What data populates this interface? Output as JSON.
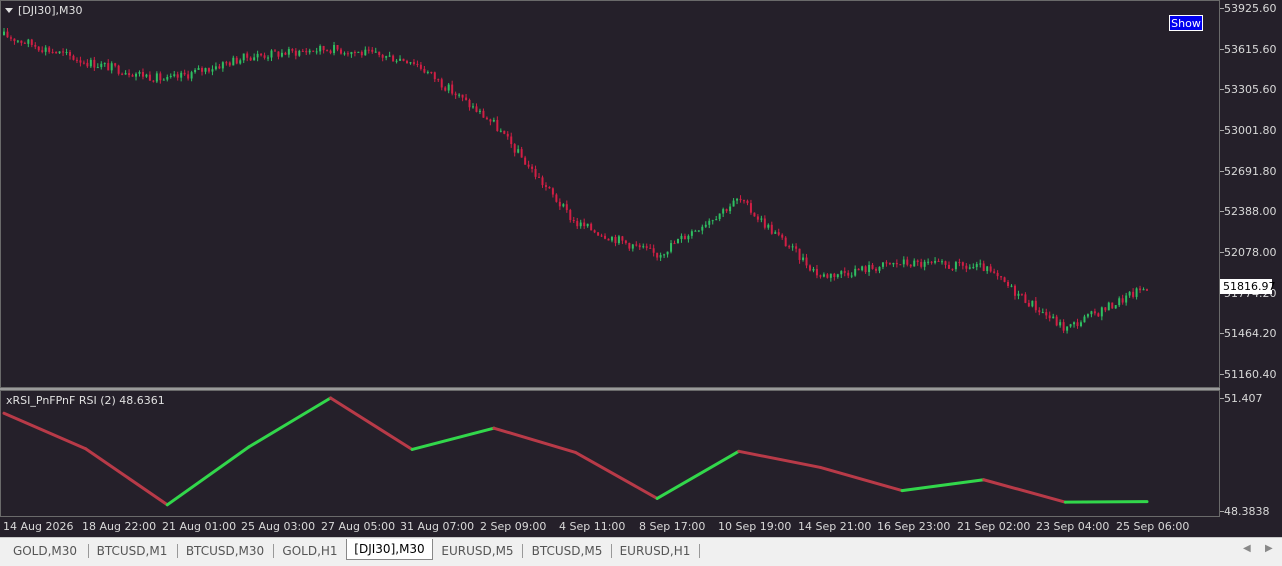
{
  "chart": {
    "title": "[DJI30],M30",
    "show_button": "Show",
    "current_price": "51816.97",
    "bull_color": "#2fbf62",
    "bear_color": "#d21f45",
    "background": "#25202a"
  },
  "price_scale": [
    "53925.60",
    "53615.60",
    "53305.60",
    "53001.80",
    "52691.80",
    "52388.00",
    "52078.00",
    "51774.20",
    "51464.20",
    "51160.40"
  ],
  "indicator": {
    "title": "xRSI_PnFPnF RSI (2) 48.6361",
    "scale_max": "51.407",
    "scale_min": "48.3838",
    "up_color": "#32d74b",
    "down_color": "#b83a48"
  },
  "time_axis": [
    "14 Aug 2026",
    "18 Aug 22:00",
    "21 Aug 01:00",
    "25 Aug 03:00",
    "27 Aug 05:00",
    "31 Aug 07:00",
    "2 Sep 09:00",
    "4 Sep 11:00",
    "8 Sep 17:00",
    "10 Sep 19:00",
    "14 Sep 21:00",
    "16 Sep 23:00",
    "21 Sep 02:00",
    "23 Sep 04:00",
    "25 Sep 06:00"
  ],
  "tabs": [
    "GOLD,M30",
    "BTCUSD,M1",
    "BTCUSD,M30",
    "GOLD,H1",
    "[DJI30],M30",
    "EURUSD,M5",
    "BTCUSD,M5",
    "EURUSD,H1"
  ],
  "active_tab": "[DJI30],M30",
  "chart_data": {
    "type": "line",
    "title": "[DJI30],M30",
    "xlabel": "",
    "ylabel": "",
    "x": [
      "14 Aug 2026",
      "18 Aug 22:00",
      "21 Aug 01:00",
      "25 Aug 03:00",
      "27 Aug 05:00",
      "31 Aug 07:00",
      "2 Sep 09:00",
      "4 Sep 11:00",
      "8 Sep 17:00",
      "10 Sep 19:00",
      "14 Sep 21:00",
      "16 Sep 23:00",
      "21 Sep 02:00",
      "23 Sep 04:00",
      "25 Sep 06:00"
    ],
    "ylim": [
      51160.4,
      53925.6
    ],
    "series": [
      {
        "values": [
          53720,
          53520,
          53380,
          53560,
          53620,
          53530,
          53050,
          52300,
          52060,
          52480,
          51900,
          52000,
          51960,
          51500,
          51820
        ]
      }
    ],
    "indicator_values": [
      51.0,
      50.05,
      48.55,
      50.1,
      51.407,
      50.03,
      50.6,
      49.95,
      48.72,
      49.98,
      49.55,
      48.93,
      49.22,
      48.62,
      48.6361
    ],
    "indicator_range": [
      48.3838,
      51.407
    ]
  }
}
